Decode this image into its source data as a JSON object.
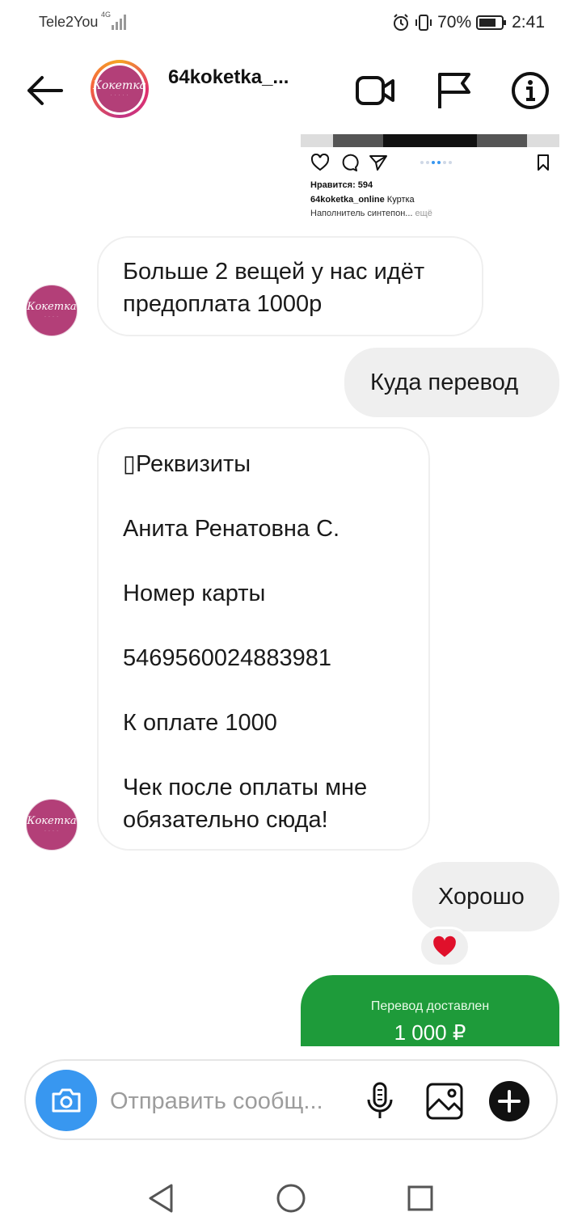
{
  "status_bar": {
    "carrier": "Tele2You",
    "network": "4G",
    "battery": "70%",
    "time": "2:41"
  },
  "header": {
    "username": "64koketka_...",
    "avatar_logo": "Кокетка",
    "icons": [
      "back-arrow-icon",
      "video-call-icon",
      "flag-icon",
      "info-icon"
    ]
  },
  "shared_post": {
    "likes": "Нравится: 594",
    "caption_user": "64koketka_online",
    "caption_text": "Куртка",
    "caption_line2": "Наполнитель синтепон...",
    "more": "ещё"
  },
  "messages": [
    {
      "direction": "in",
      "text": "Больше 2 вещей у нас идёт предоплата 1000р"
    },
    {
      "direction": "out",
      "text": "Куда перевод"
    },
    {
      "direction": "in",
      "lines": [
        "▯Реквизиты",
        "Анита Ренатовна С.",
        "Номер карты",
        "5469560024883981",
        "К оплате 1000",
        "Чек после оплаты мне обязательно сюда!"
      ]
    },
    {
      "direction": "out",
      "text": "Хорошо",
      "reaction": "❤"
    }
  ],
  "transfer": {
    "title": "Перевод доставлен",
    "amount": "1 000 ₽"
  },
  "composer": {
    "placeholder": "Отправить сообщ..."
  },
  "colors": {
    "accent": "#3897f0",
    "brand": "#b33f78",
    "transfer_green": "#1e9b3a",
    "heart": "#e0102b"
  }
}
